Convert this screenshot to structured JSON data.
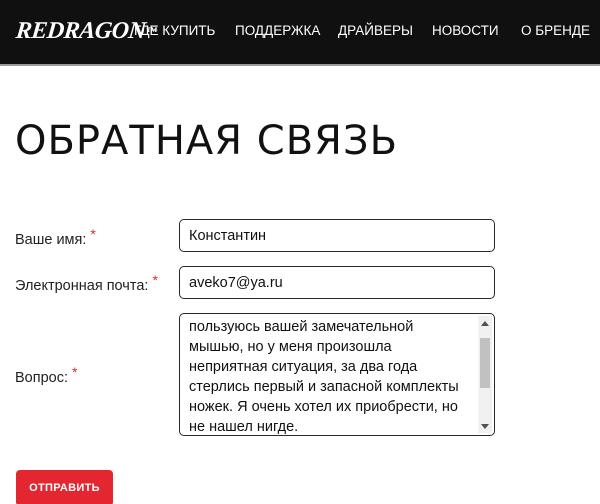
{
  "brand": {
    "logo_text": "REDRAGON",
    "trademark": "TM"
  },
  "nav": {
    "items": [
      {
        "label": "ГДЕ КУПИТЬ"
      },
      {
        "label": "ПОДДЕРЖКА"
      },
      {
        "label": "ДРАЙВЕРЫ"
      },
      {
        "label": "НОВОСТИ"
      },
      {
        "label": "О БРЕНДЕ"
      }
    ]
  },
  "page": {
    "title": "ОБРАТНАЯ СВЯЗЬ"
  },
  "form": {
    "required_mark": "*",
    "name_label": "Ваше имя:",
    "name_value": "Константин",
    "email_label": "Электронная почта:",
    "email_value": "aveko7@ya.ru",
    "question_label": "Вопрос:",
    "question_value": "пользуюсь вашей замечательной мышью, но у меня произошла неприятная ситуация, за два года стерлись первый и запасной комплекты ножек. Я очень хотел их приобрести, но не нашел нигде.",
    "submit_label": "ОТПРАВИТЬ"
  },
  "colors": {
    "header_bg": "#101010",
    "accent_red": "#e32630",
    "required_red": "#e0282f"
  }
}
